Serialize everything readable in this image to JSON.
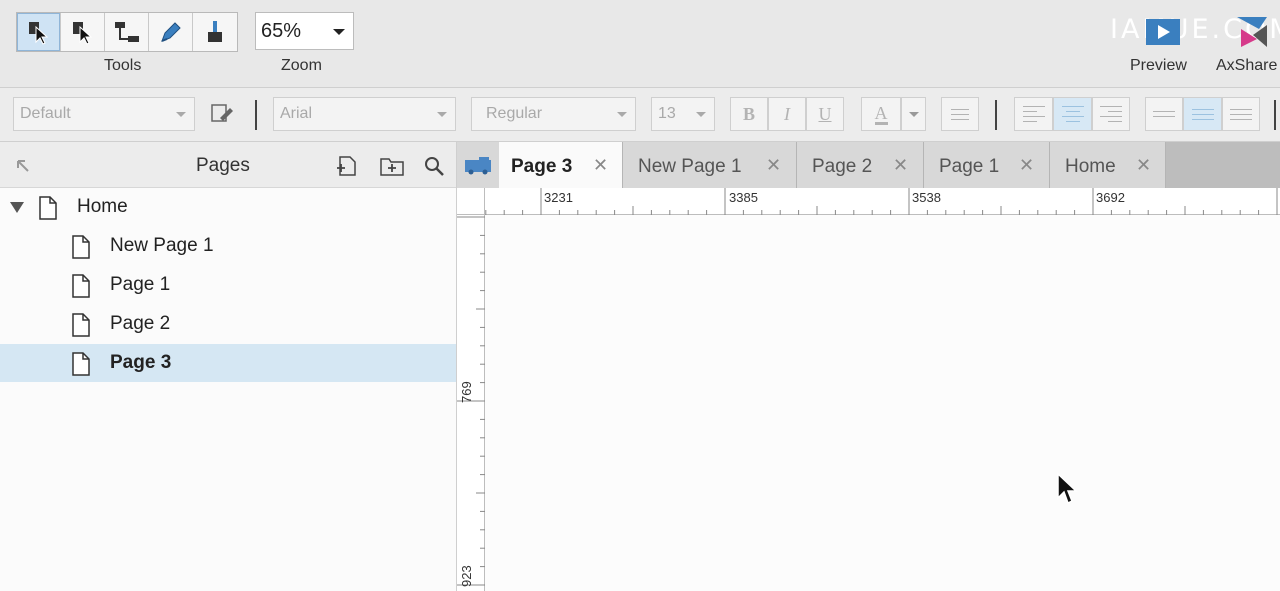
{
  "toolbar": {
    "tools_caption": "Tools",
    "zoom_caption": "Zoom",
    "zoom_value": "65%",
    "preview_label": "Preview",
    "axshare_label": "AxShare",
    "watermark": "IAMUE.COM",
    "tools": [
      {
        "name": "select-intersected-icon",
        "active": true
      },
      {
        "name": "select-contained-icon",
        "active": false
      },
      {
        "name": "connector-icon",
        "active": false
      },
      {
        "name": "pen-icon",
        "active": false
      },
      {
        "name": "format-painter-icon",
        "active": false
      }
    ]
  },
  "formatbar": {
    "style_value": "Default",
    "font_value": "Arial",
    "weight_value": "Regular",
    "size_value": "13",
    "bold": "B",
    "italic": "I",
    "underline": "U",
    "text_color": "A"
  },
  "pages_panel": {
    "title": "Pages",
    "items": [
      {
        "label": "Home",
        "level": 0,
        "expanded": true,
        "selected": false
      },
      {
        "label": "New Page 1",
        "level": 1,
        "selected": false
      },
      {
        "label": "Page 1",
        "level": 1,
        "selected": false
      },
      {
        "label": "Page 2",
        "level": 1,
        "selected": false
      },
      {
        "label": "Page 3",
        "level": 1,
        "selected": true
      }
    ]
  },
  "tabs": [
    {
      "label": "Page 3",
      "active": true
    },
    {
      "label": "New Page 1",
      "active": false
    },
    {
      "label": "Page 2",
      "active": false
    },
    {
      "label": "Page 1",
      "active": false
    },
    {
      "label": "Home",
      "active": false
    }
  ],
  "rulers": {
    "horizontal": [
      "3231",
      "3385",
      "3538",
      "3692"
    ],
    "vertical": [
      "769",
      "923"
    ]
  },
  "colors": {
    "selection": "#d5e7f3",
    "accent": "#3a8fd0"
  }
}
